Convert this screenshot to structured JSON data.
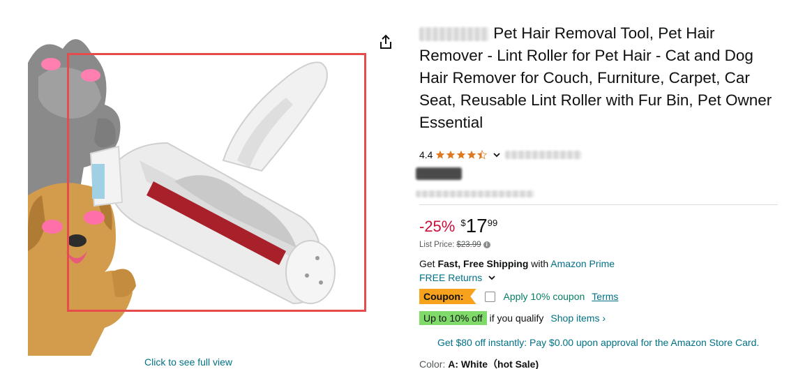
{
  "image": {
    "full_view_link": "Click to see full view"
  },
  "product": {
    "title": "Pet Hair Removal Tool, Pet Hair Remover - Lint Roller for Pet Hair - Cat and Dog Hair Remover for Couch, Furniture, Carpet, Car Seat, Reusable Lint Roller with Fur Bin, Pet Owner Essential",
    "rating": "4.4",
    "rating_value": 4.4
  },
  "price": {
    "discount": "-25%",
    "symbol": "$",
    "whole": "17",
    "fraction": "99",
    "list_label": "List Price:",
    "list_value": "$23.99"
  },
  "shipping": {
    "get": "Get ",
    "bold": "Fast, Free Shipping",
    "with": " with ",
    "prime_link": "Amazon Prime",
    "returns_link": "FREE Returns"
  },
  "coupon": {
    "badge": "Coupon:",
    "apply_text": "Apply 10% coupon",
    "terms_link": "Terms"
  },
  "promo": {
    "badge": "Up to 10% off",
    "qualify": "if you qualify",
    "shop_link": "Shop items ›"
  },
  "store_card": "Get $80 off instantly: Pay $0.00 upon approval for the Amazon Store Card.",
  "color": {
    "label": "Color:",
    "value": "A: White（hot Sale)"
  },
  "colors": {
    "price_red": "#cc0c39",
    "link_teal": "#007185",
    "coupon_orange": "#f7a21d",
    "promo_green": "#7fda69",
    "highlight_red": "#e74c4c",
    "star_orange": "#de7921"
  }
}
